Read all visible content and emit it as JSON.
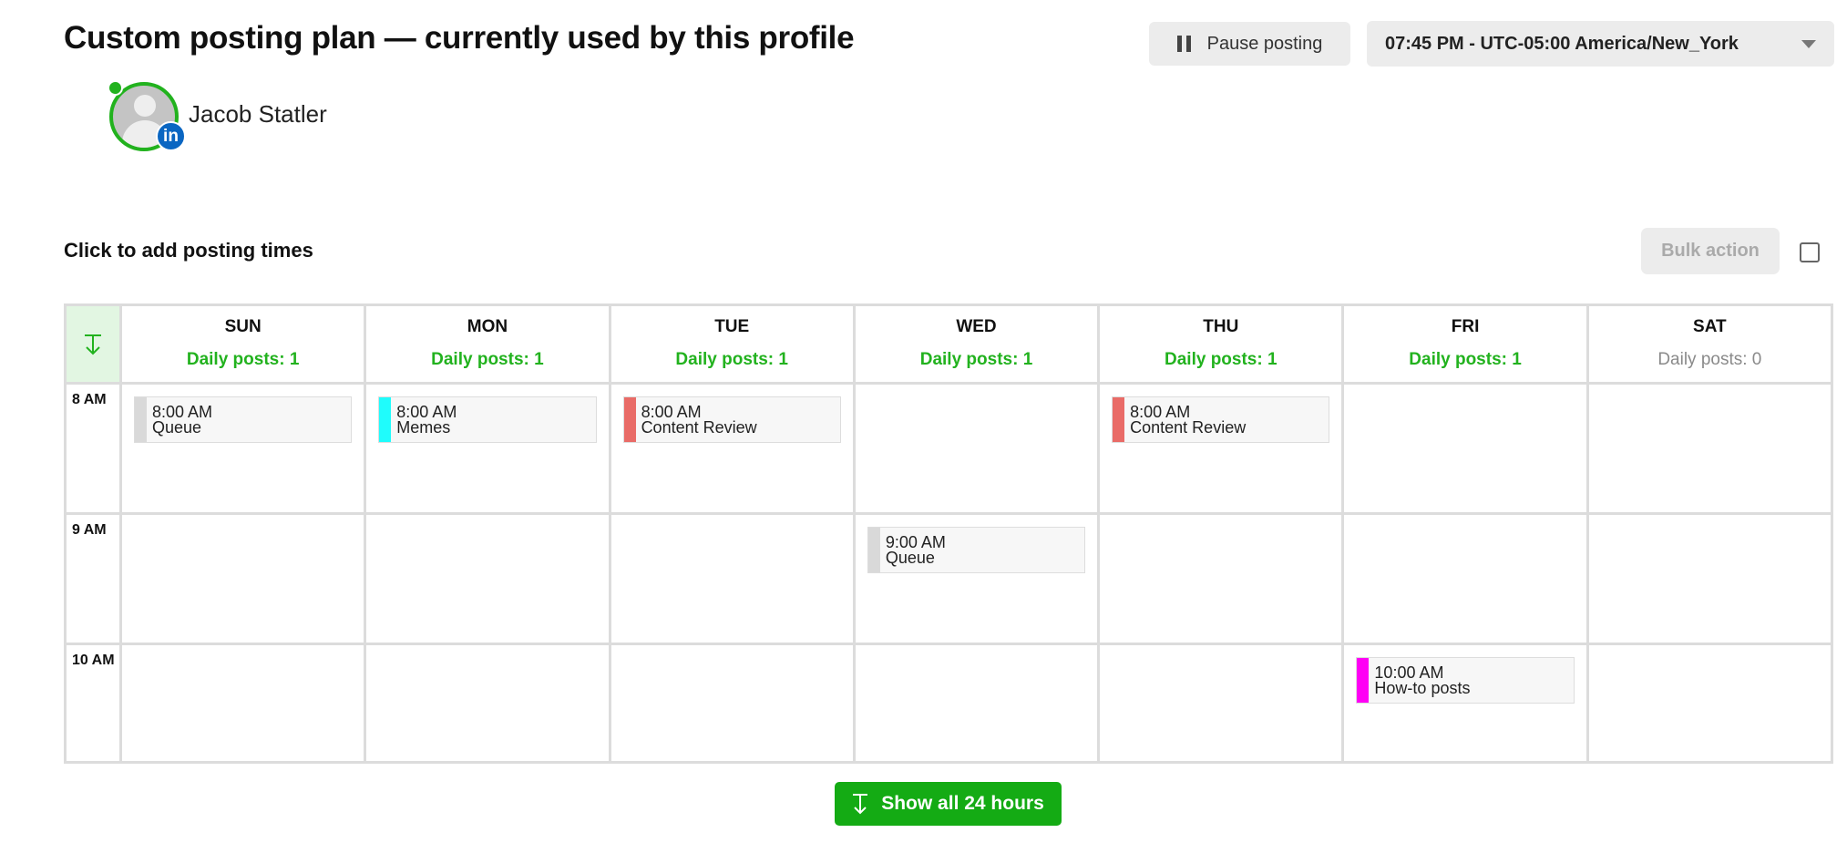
{
  "header": {
    "title": "Custom posting plan — currently used by this profile",
    "pause_label": "Pause posting",
    "timezone_selected": "07:45 PM - UTC-05:00 America/New_York"
  },
  "profile": {
    "name": "Jacob Statler",
    "network": "LinkedIn",
    "network_badge": "in",
    "status": "online"
  },
  "toolbar": {
    "hint": "Click to add posting times",
    "bulk_action_label": "Bulk action",
    "bulk_action_enabled": false,
    "select_all_checked": false
  },
  "calendar": {
    "days": [
      {
        "name": "SUN",
        "count_label": "Daily posts: 1"
      },
      {
        "name": "MON",
        "count_label": "Daily posts: 1"
      },
      {
        "name": "TUE",
        "count_label": "Daily posts: 1"
      },
      {
        "name": "WED",
        "count_label": "Daily posts: 1"
      },
      {
        "name": "THU",
        "count_label": "Daily posts: 1"
      },
      {
        "name": "FRI",
        "count_label": "Daily posts: 1"
      },
      {
        "name": "SAT",
        "count_label": "Daily posts: 0"
      }
    ],
    "hours": [
      "8 AM",
      "9 AM",
      "10 AM"
    ],
    "events": [
      {
        "day": 0,
        "hour": 0,
        "time": "8:00 AM",
        "category": "Queue",
        "color": "#d9d9d9"
      },
      {
        "day": 1,
        "hour": 0,
        "time": "8:00 AM",
        "category": "Memes",
        "color": "#1ffcfc"
      },
      {
        "day": 2,
        "hour": 0,
        "time": "8:00 AM",
        "category": "Content Review",
        "color": "#e96b67"
      },
      {
        "day": 4,
        "hour": 0,
        "time": "8:00 AM",
        "category": "Content Review",
        "color": "#e96b67"
      },
      {
        "day": 3,
        "hour": 1,
        "time": "9:00 AM",
        "category": "Queue",
        "color": "#d9d9d9"
      },
      {
        "day": 5,
        "hour": 2,
        "time": "10:00 AM",
        "category": "How-to posts",
        "color": "#ff00f5"
      }
    ]
  },
  "footer": {
    "show_all_label": "Show all 24 hours"
  },
  "colors": {
    "accent": "#14ab14",
    "accent_text": "#22b21e",
    "corner_bg": "#e2f6e2"
  }
}
